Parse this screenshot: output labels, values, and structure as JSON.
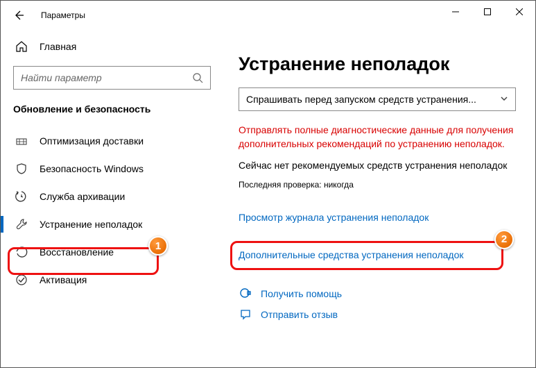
{
  "titlebar": {
    "title": "Параметры"
  },
  "sidebar": {
    "home": "Главная",
    "search_placeholder": "Найти параметр",
    "section": "Обновление и безопасность",
    "items": [
      {
        "label": "Оптимизация доставки",
        "icon": "delivery-icon"
      },
      {
        "label": "Безопасность Windows",
        "icon": "shield-icon"
      },
      {
        "label": "Служба архивации",
        "icon": "backup-icon"
      },
      {
        "label": "Устранение неполадок",
        "icon": "wrench-icon",
        "selected": true
      },
      {
        "label": "Восстановление",
        "icon": "recovery-icon"
      },
      {
        "label": "Активация",
        "icon": "activation-icon"
      }
    ]
  },
  "main": {
    "title": "Устранение неполадок",
    "combo_value": "Спрашивать перед запуском средств устранения...",
    "warning": "Отправлять полные диагностические данные для получения дополнительных рекомендаций по устранению неполадок.",
    "status": "Сейчас нет рекомендуемых средств устранения неполадок",
    "last_check_label": "Последняя проверка: никогда",
    "link_history": "Просмотр журнала устранения неполадок",
    "link_additional": "Дополнительные средства устранения неполадок",
    "help": "Получить помощь",
    "feedback": "Отправить отзыв"
  },
  "badges": {
    "one": "1",
    "two": "2"
  }
}
